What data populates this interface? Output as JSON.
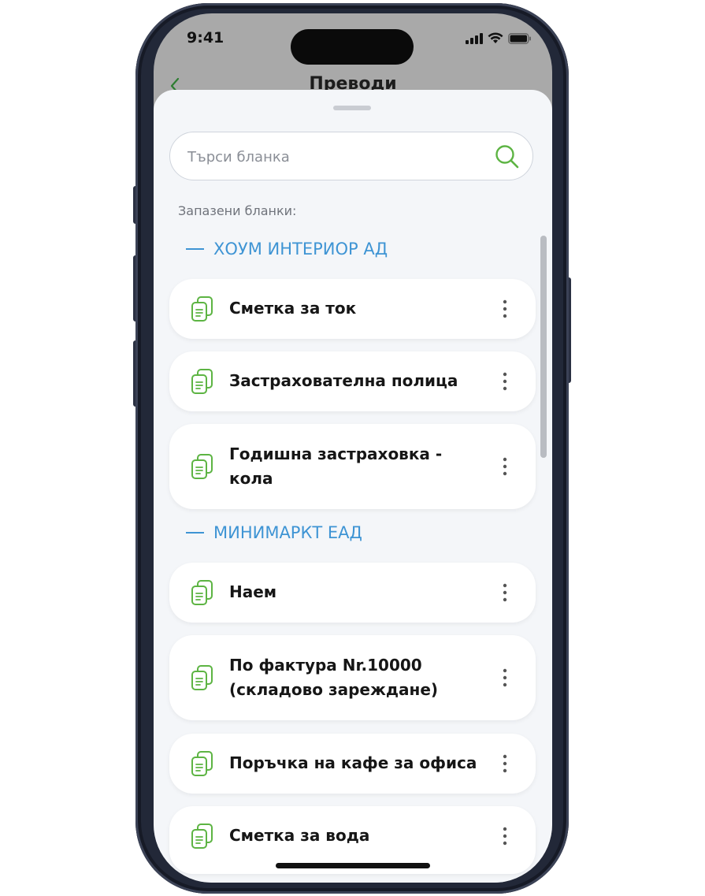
{
  "status_bar": {
    "time": "9:41"
  },
  "nav": {
    "title": "Преводи",
    "back_icon": "chevron-left-icon"
  },
  "search": {
    "placeholder": "Търси бланка",
    "value": "",
    "icon": "search-icon"
  },
  "saved_label": "Запазени бланки:",
  "groups": [
    {
      "name": "ХОУМ ИНТЕРИОР АД",
      "items": [
        {
          "title": "Сметка за ток"
        },
        {
          "title": "Застрахователна полица"
        },
        {
          "title": "Годишна застраховка - кола"
        }
      ]
    },
    {
      "name": "МИНИМАРКТ ЕАД",
      "items": [
        {
          "title": "Наем"
        },
        {
          "title": "По фактура Nr.10000 (складово зареждане)"
        },
        {
          "title": "Поръчка на кафе за офиса"
        },
        {
          "title": "Сметка за вода"
        }
      ]
    }
  ],
  "colors": {
    "accent_green": "#5db443",
    "group_blue": "#3e94d4",
    "sheet_bg": "#f4f6f9"
  }
}
